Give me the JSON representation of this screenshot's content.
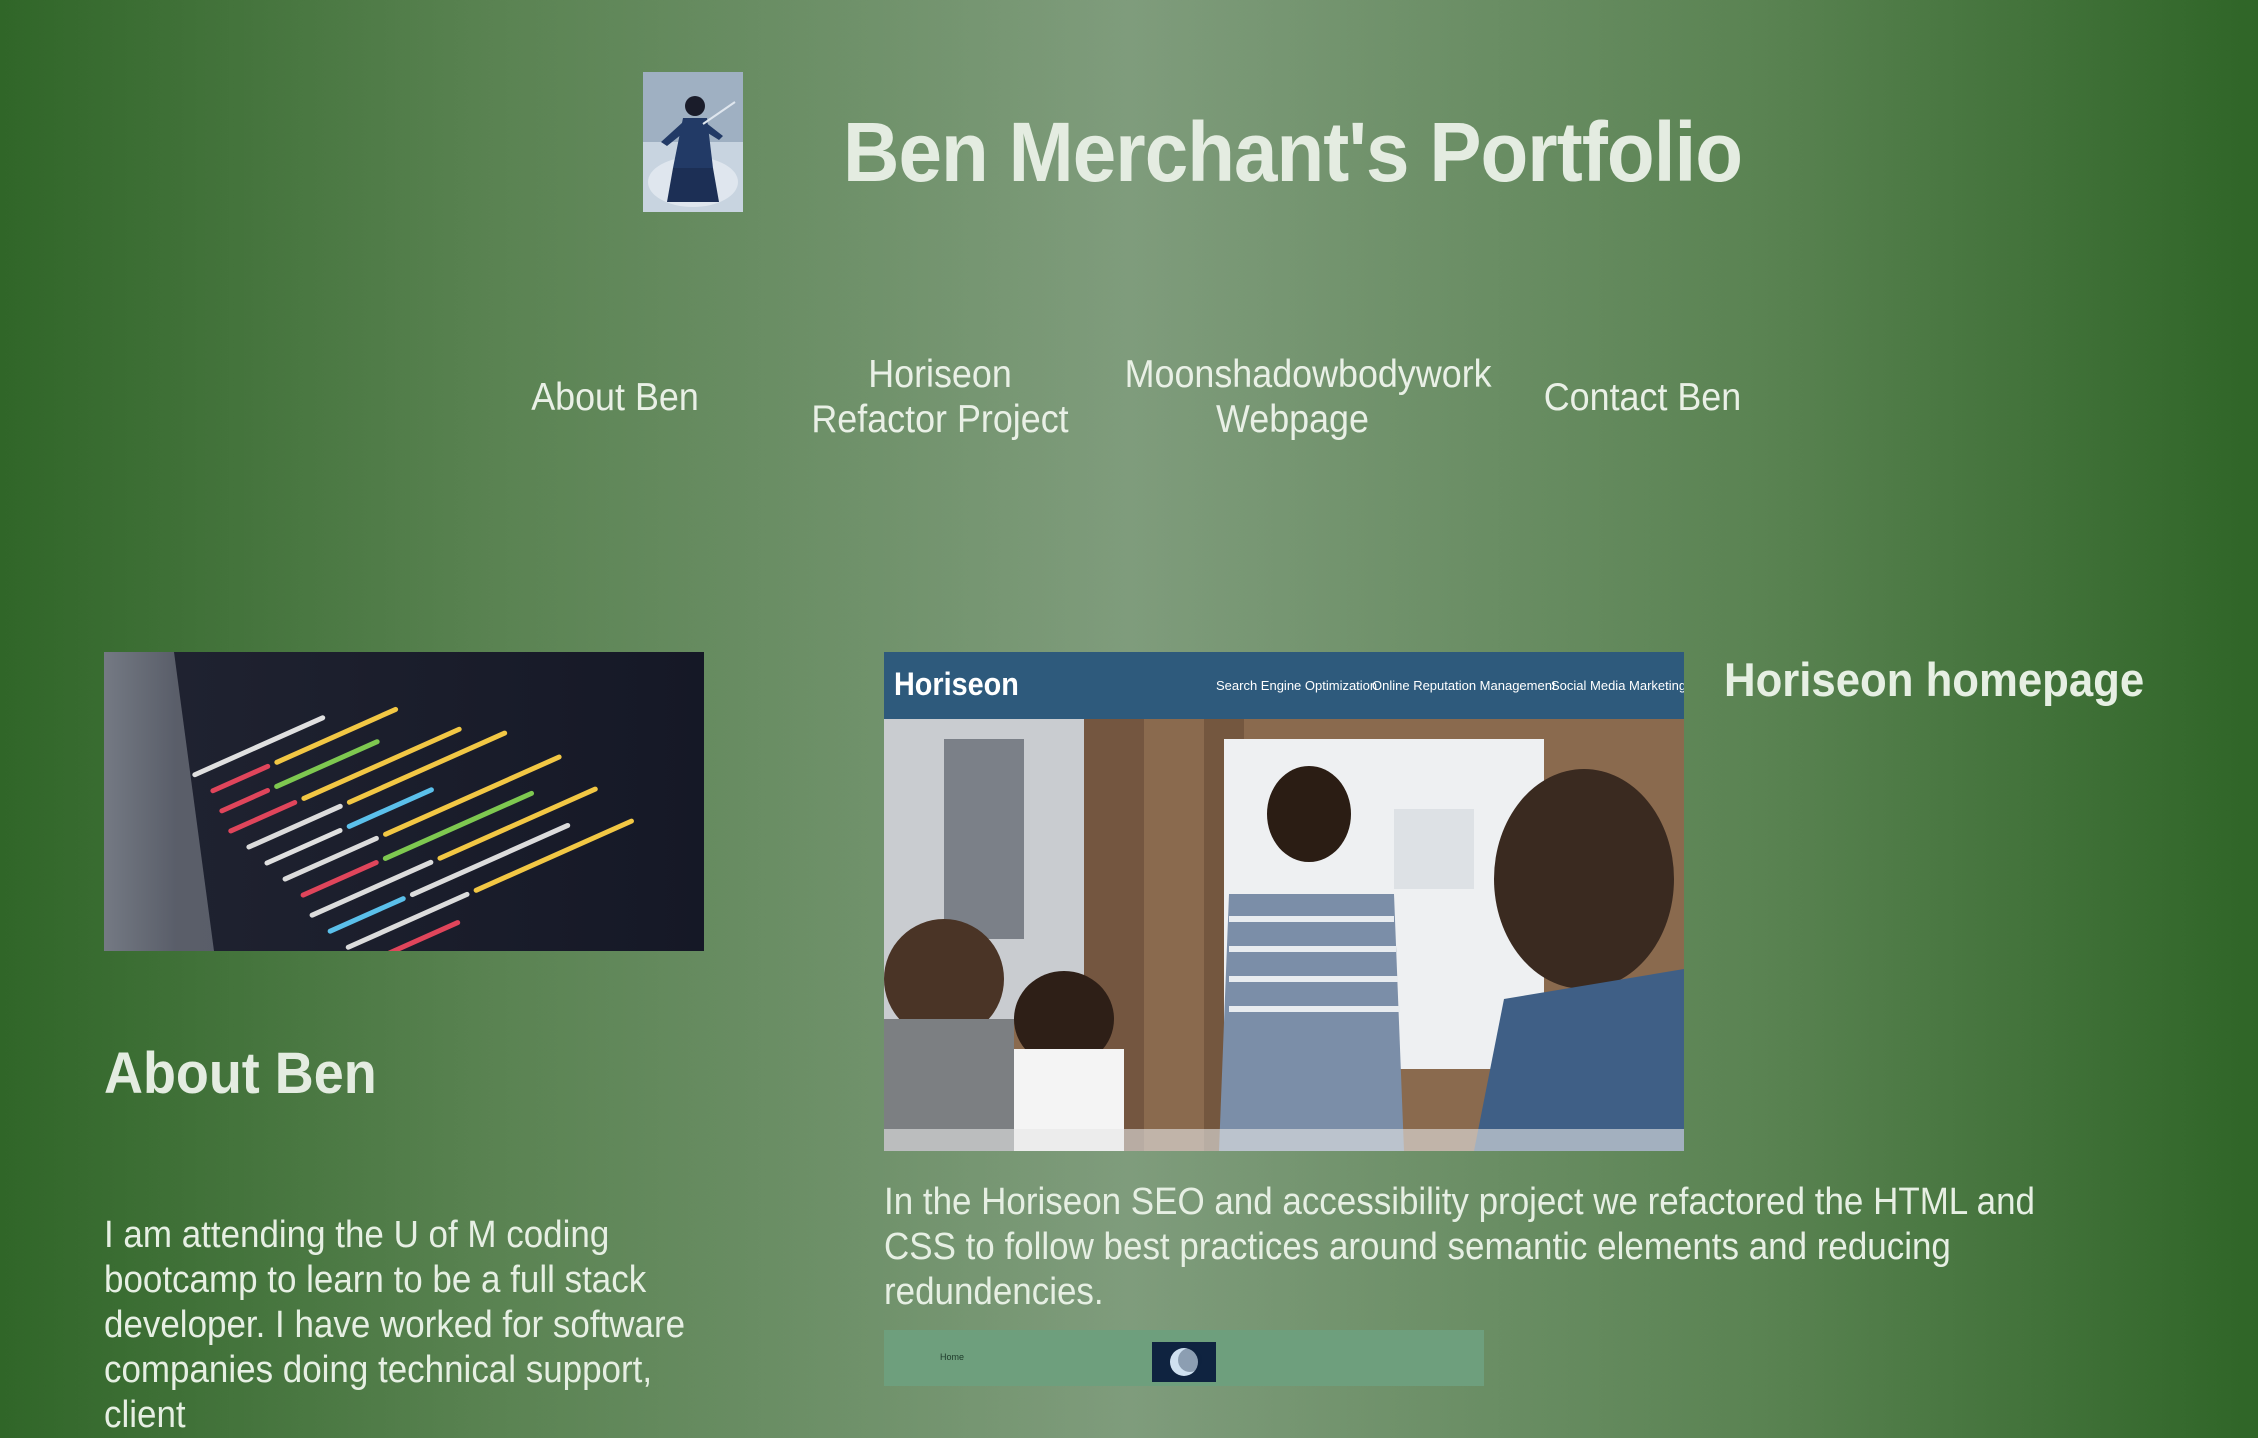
{
  "header": {
    "title": "Ben Merchant's Portfolio",
    "avatar_icon": "warrior-avatar-image"
  },
  "nav": {
    "items": [
      {
        "label": "About Ben"
      },
      {
        "label": "Horiseon Refactor Project"
      },
      {
        "label": "Moonshadowbodywork Webpage"
      },
      {
        "label": "Contact Ben"
      }
    ]
  },
  "about": {
    "heading": "About Ben",
    "text": "I am attending the U of M coding bootcamp to learn to be a full stack developer. I have worked for software companies doing technical support, client",
    "image_icon": "code-screen-image"
  },
  "projects": {
    "horiseon": {
      "caption": "Horiseon homepage",
      "description": "In the Horiseon SEO and accessibility project we refactored the HTML and CSS to follow best practices around semantic elements and reducing redundencies.",
      "screenshot": {
        "brand": "Horiseon",
        "nav": [
          "Search Engine Optimization",
          "Online Reputation Management",
          "Social Media Marketing"
        ]
      }
    },
    "moonshadow": {
      "screenshot": {
        "nav_label": "Home"
      }
    }
  },
  "colors": {
    "background_edge": "#306628",
    "background_center": "#7f9c7c",
    "text": "#e6efe3",
    "horiseon_header": "#2e5a7c"
  }
}
